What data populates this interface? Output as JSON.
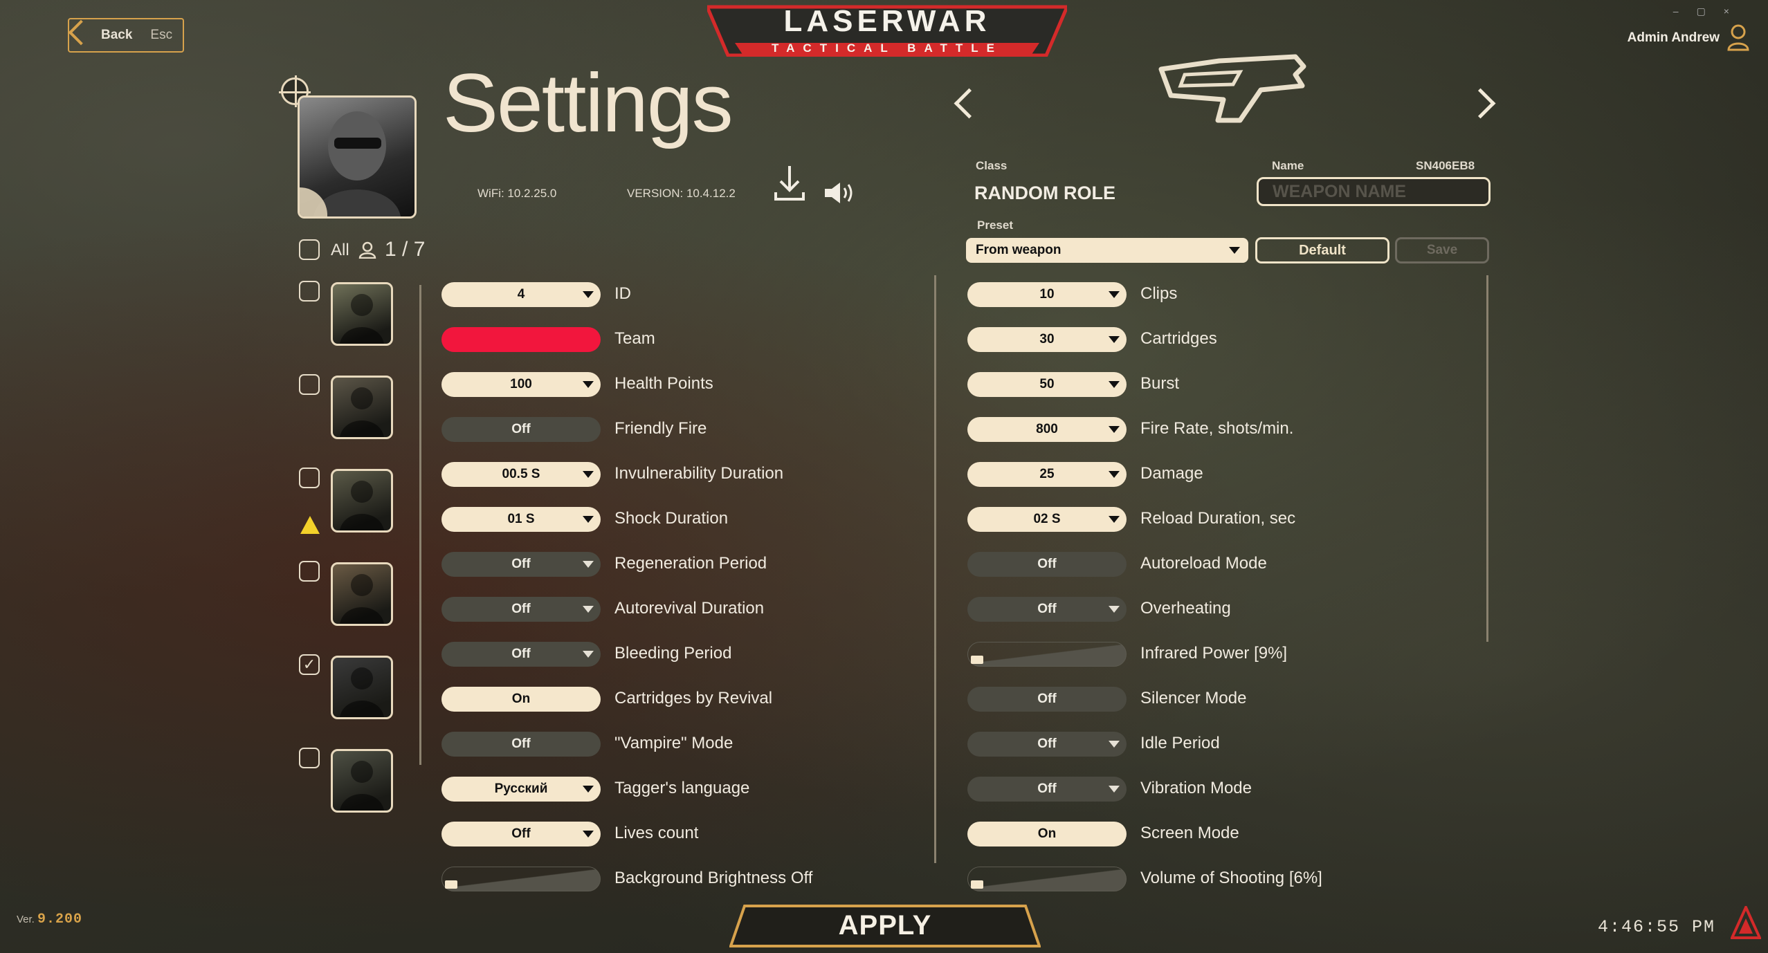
{
  "topbar": {
    "back_label": "Back",
    "esc_label": "Esc",
    "user_name": "Admin Andrew",
    "logo_main": "LASERWAR",
    "logo_sub": "TACTICAL BATTLE"
  },
  "header": {
    "title": "Settings",
    "wifi": "WiFi: 10.2.25.0",
    "version": "VERSION: 10.4.12.2"
  },
  "selection": {
    "all_label": "All",
    "count": "1 / 7"
  },
  "players": [
    {
      "checked": false,
      "warning": false
    },
    {
      "checked": false,
      "warning": false
    },
    {
      "checked": false,
      "warning": true
    },
    {
      "checked": false,
      "warning": false
    },
    {
      "checked": true,
      "warning": false
    },
    {
      "checked": false,
      "warning": false
    }
  ],
  "player_settings": [
    {
      "value": "4",
      "label": "ID",
      "state": "on",
      "dropdown": true
    },
    {
      "value": "",
      "label": "Team",
      "state": "team",
      "dropdown": false,
      "color": "#f2163d"
    },
    {
      "value": "100",
      "label": "Health Points",
      "state": "on",
      "dropdown": true
    },
    {
      "value": "Off",
      "label": "Friendly Fire",
      "state": "off",
      "dropdown": false
    },
    {
      "value": "00.5 S",
      "label": "Invulnerability Duration",
      "state": "on",
      "dropdown": true
    },
    {
      "value": "01 S",
      "label": "Shock Duration",
      "state": "on",
      "dropdown": true
    },
    {
      "value": "Off",
      "label": "Regeneration Period",
      "state": "off",
      "dropdown": true
    },
    {
      "value": "Off",
      "label": "Autorevival Duration",
      "state": "off",
      "dropdown": true
    },
    {
      "value": "Off",
      "label": "Bleeding Period",
      "state": "off",
      "dropdown": true
    },
    {
      "value": "On",
      "label": "Cartridges by Revival",
      "state": "on",
      "dropdown": false
    },
    {
      "value": "Off",
      "label": "\"Vampire\" Mode",
      "state": "off",
      "dropdown": false
    },
    {
      "value": "Русский",
      "label": "Tagger's language",
      "state": "on",
      "dropdown": true
    },
    {
      "value": "Off",
      "label": "Lives count",
      "state": "on",
      "dropdown": true
    },
    {
      "value": "",
      "label": "Background Brightness Off",
      "state": "slider",
      "dropdown": false,
      "level": 0
    }
  ],
  "weapon": {
    "class_label": "Class",
    "class_value": "RANDOM ROLE",
    "name_label": "Name",
    "serial": "SN406EB8",
    "name_placeholder": "WEAPON NAME",
    "preset_label": "Preset",
    "preset_value": "From weapon",
    "default_label": "Default",
    "save_label": "Save"
  },
  "weapon_settings": [
    {
      "value": "10",
      "label": "Clips",
      "state": "on",
      "dropdown": true
    },
    {
      "value": "30",
      "label": "Cartridges",
      "state": "on",
      "dropdown": true
    },
    {
      "value": "50",
      "label": "Burst",
      "state": "on",
      "dropdown": true
    },
    {
      "value": "800",
      "label": "Fire Rate, shots/min.",
      "state": "on",
      "dropdown": true
    },
    {
      "value": "25",
      "label": "Damage",
      "state": "on",
      "dropdown": true
    },
    {
      "value": "02 S",
      "label": "Reload Duration, sec",
      "state": "on",
      "dropdown": true
    },
    {
      "value": "Off",
      "label": "Autoreload Mode",
      "state": "off",
      "dropdown": false
    },
    {
      "value": "Off",
      "label": "Overheating",
      "state": "off",
      "dropdown": true
    },
    {
      "value": "",
      "label": "Infrared Power [9%]",
      "state": "slider",
      "dropdown": false,
      "level": 9
    },
    {
      "value": "Off",
      "label": "Silencer Mode",
      "state": "off",
      "dropdown": false
    },
    {
      "value": "Off",
      "label": "Idle Period",
      "state": "off",
      "dropdown": true
    },
    {
      "value": "Off",
      "label": "Vibration Mode",
      "state": "off",
      "dropdown": true
    },
    {
      "value": "On",
      "label": "Screen Mode",
      "state": "on",
      "dropdown": false
    },
    {
      "value": "",
      "label": "Volume of Shooting [6%]",
      "state": "slider",
      "dropdown": false,
      "level": 6
    }
  ],
  "footer": {
    "apply_label": "APPLY",
    "ver_label": "Ver.",
    "ver_value": "9.200",
    "clock": "4:46:55 PM"
  },
  "colors": {
    "accent": "#d7a24c",
    "cream": "#f5e7cc",
    "team": "#f2163d",
    "logo_red": "#d42a2a"
  }
}
